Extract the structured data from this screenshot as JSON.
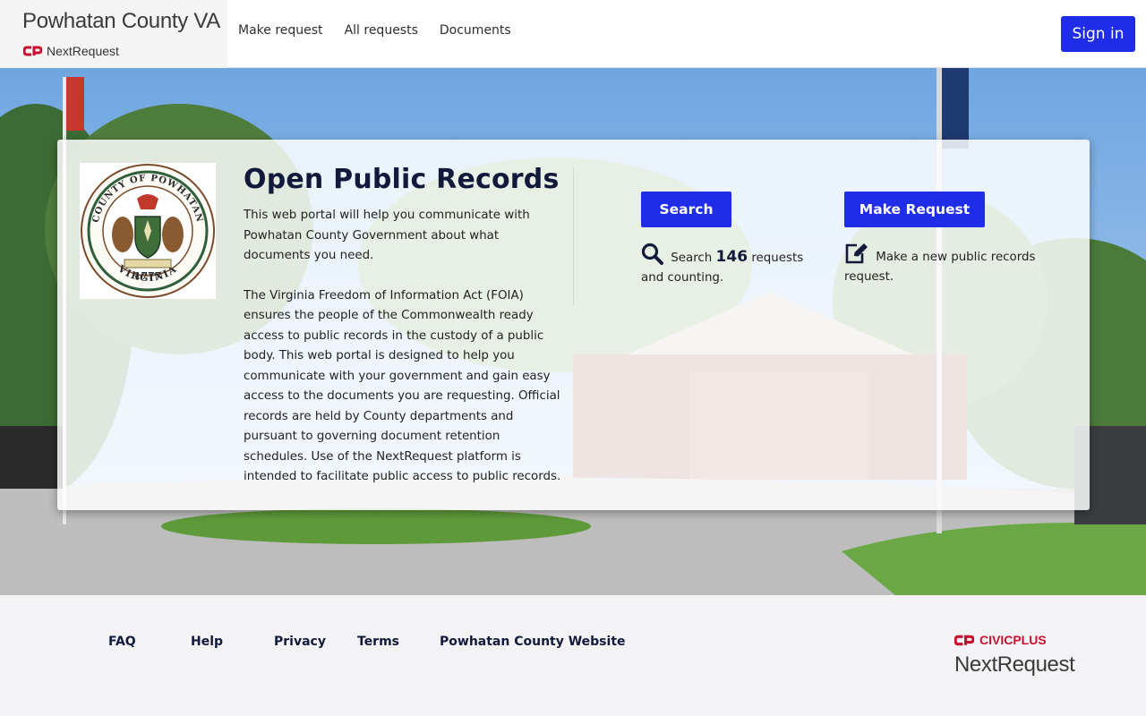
{
  "header": {
    "site_title": "Powhatan County VA",
    "platform_name": "NextRequest",
    "nav": [
      {
        "label": "Make request"
      },
      {
        "label": "All requests"
      },
      {
        "label": "Documents"
      }
    ],
    "sign_in_label": "Sign in"
  },
  "hero": {
    "title": "Open Public Records",
    "intro_p1": "This web portal will help you communicate with Powhatan County Government about what documents you need.",
    "intro_p2": "The Virginia Freedom of Information Act (FOIA) ensures the people of the Commonwealth ready access to public records in the custody of a public body. This web portal is designed to help you communicate with your government and gain easy access to the documents you are requesting. Official records are held by County departments and pursuant to governing document retention schedules. Use of the NextRequest platform is intended to facilitate public access to public records.",
    "seal": {
      "top_text": "COUNTY OF POWHATAN",
      "bottom_text": "VIRGINIA",
      "year": "1777"
    },
    "search": {
      "button_label": "Search",
      "text_before": "Search",
      "count": "146",
      "text_after": "requests and counting.",
      "icon": "search-icon"
    },
    "make_request": {
      "button_label": "Make Request",
      "text": "Make a new public records request.",
      "icon": "edit-icon"
    }
  },
  "footer": {
    "links": [
      {
        "label": "FAQ"
      },
      {
        "label": "Help"
      },
      {
        "label": "Privacy"
      },
      {
        "label": "Terms"
      },
      {
        "label": "Powhatan County Website"
      }
    ],
    "civicplus_label": "CIVICPLUS",
    "nextrequest_label": "NextRequest"
  },
  "colors": {
    "primary": "#1f2de8",
    "heading": "#111a3a",
    "civicplus_red": "#c8102e"
  }
}
